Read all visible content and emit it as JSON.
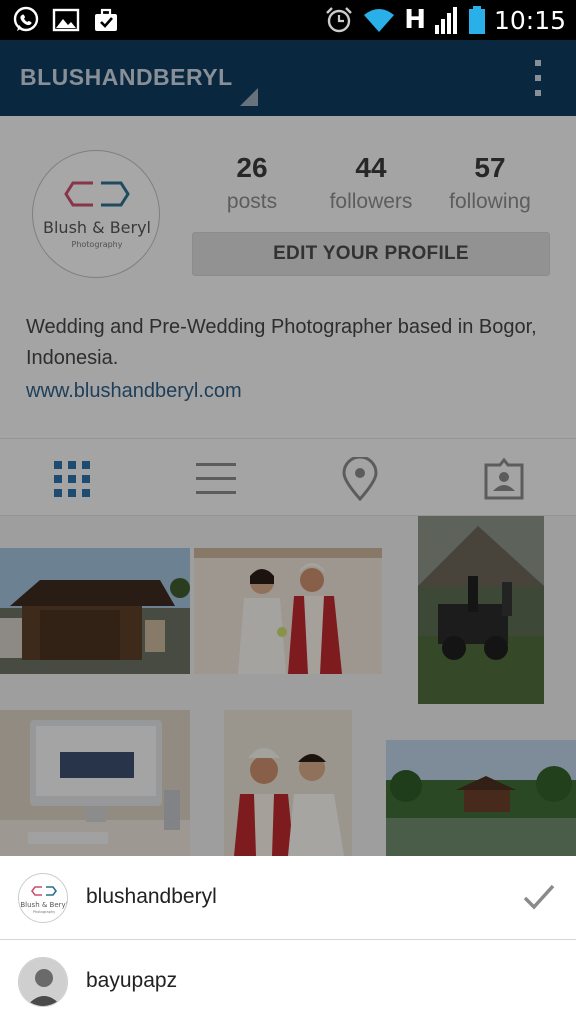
{
  "status_bar": {
    "clock": "10:15",
    "network_letter": "H",
    "icons": [
      "whatsapp-icon",
      "image-icon",
      "briefcase-icon",
      "alarm-icon",
      "wifi-icon",
      "signal-icon",
      "battery-icon"
    ]
  },
  "app_bar": {
    "account_name": "BLUSHANDBERYL",
    "overflow_icon": "more-vert-icon"
  },
  "profile": {
    "logo_text": "Blush & Beryl",
    "logo_subtext": "Photography",
    "stats": [
      {
        "value": "26",
        "label": "posts"
      },
      {
        "value": "44",
        "label": "followers"
      },
      {
        "value": "57",
        "label": "following"
      }
    ],
    "edit_button": "EDIT YOUR PROFILE",
    "bio": "Wedding and Pre-Wedding Photographer based in Bogor, Indonesia.",
    "website": "www.blushandberyl.com"
  },
  "view_tabs": [
    "grid-icon",
    "list-icon",
    "location-pin-icon",
    "tagged-person-icon"
  ],
  "colors": {
    "app_bar": "#0f3a5f",
    "accent_blue": "#2d5d85",
    "status_bar": "#000000"
  },
  "account_switcher": {
    "accounts": [
      {
        "username": "blushandberyl",
        "selected": true,
        "avatar_text": "Blush & Beryl",
        "avatar_subtext": "Photography"
      },
      {
        "username": "bayupapz",
        "selected": false
      }
    ]
  }
}
